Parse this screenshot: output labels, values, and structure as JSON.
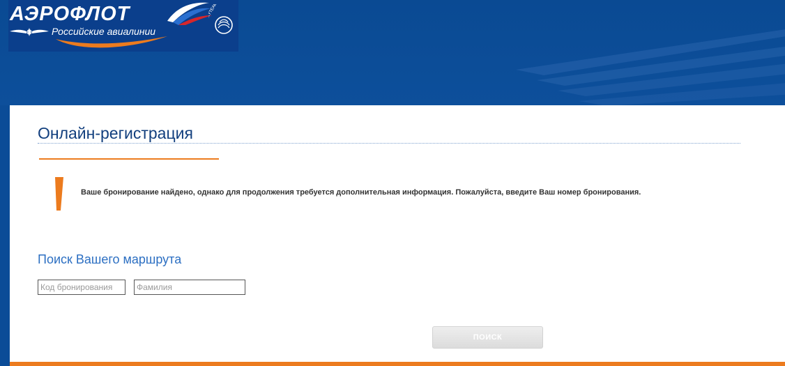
{
  "header": {
    "logo": {
      "brand": "АЭРОФЛОТ",
      "tagline": "Российские авиалинии",
      "partner": "SKYTEAM"
    }
  },
  "content": {
    "page_title": "Онлайн-регистрация",
    "message": "Ваше бронирование найдено, однако для продолжения требуется дополнительная информация. Пожалуйста, введите Ваш номер бронирования.",
    "search": {
      "section_title": "Поиск Вашего маршрута",
      "booking_code": {
        "value": "",
        "placeholder": "Код бронирования"
      },
      "surname": {
        "value": "",
        "placeholder": "Фамилия"
      },
      "button_label": "ПОИСК"
    }
  },
  "colors": {
    "header_blue": "#0b4c97",
    "accent_orange": "#ec7b1e",
    "title_blue": "#123f7e",
    "section_blue": "#2c6fc2"
  },
  "icons": [
    "wings-icon",
    "russian-flag-icon",
    "skyteam-icon",
    "warning-icon"
  ]
}
